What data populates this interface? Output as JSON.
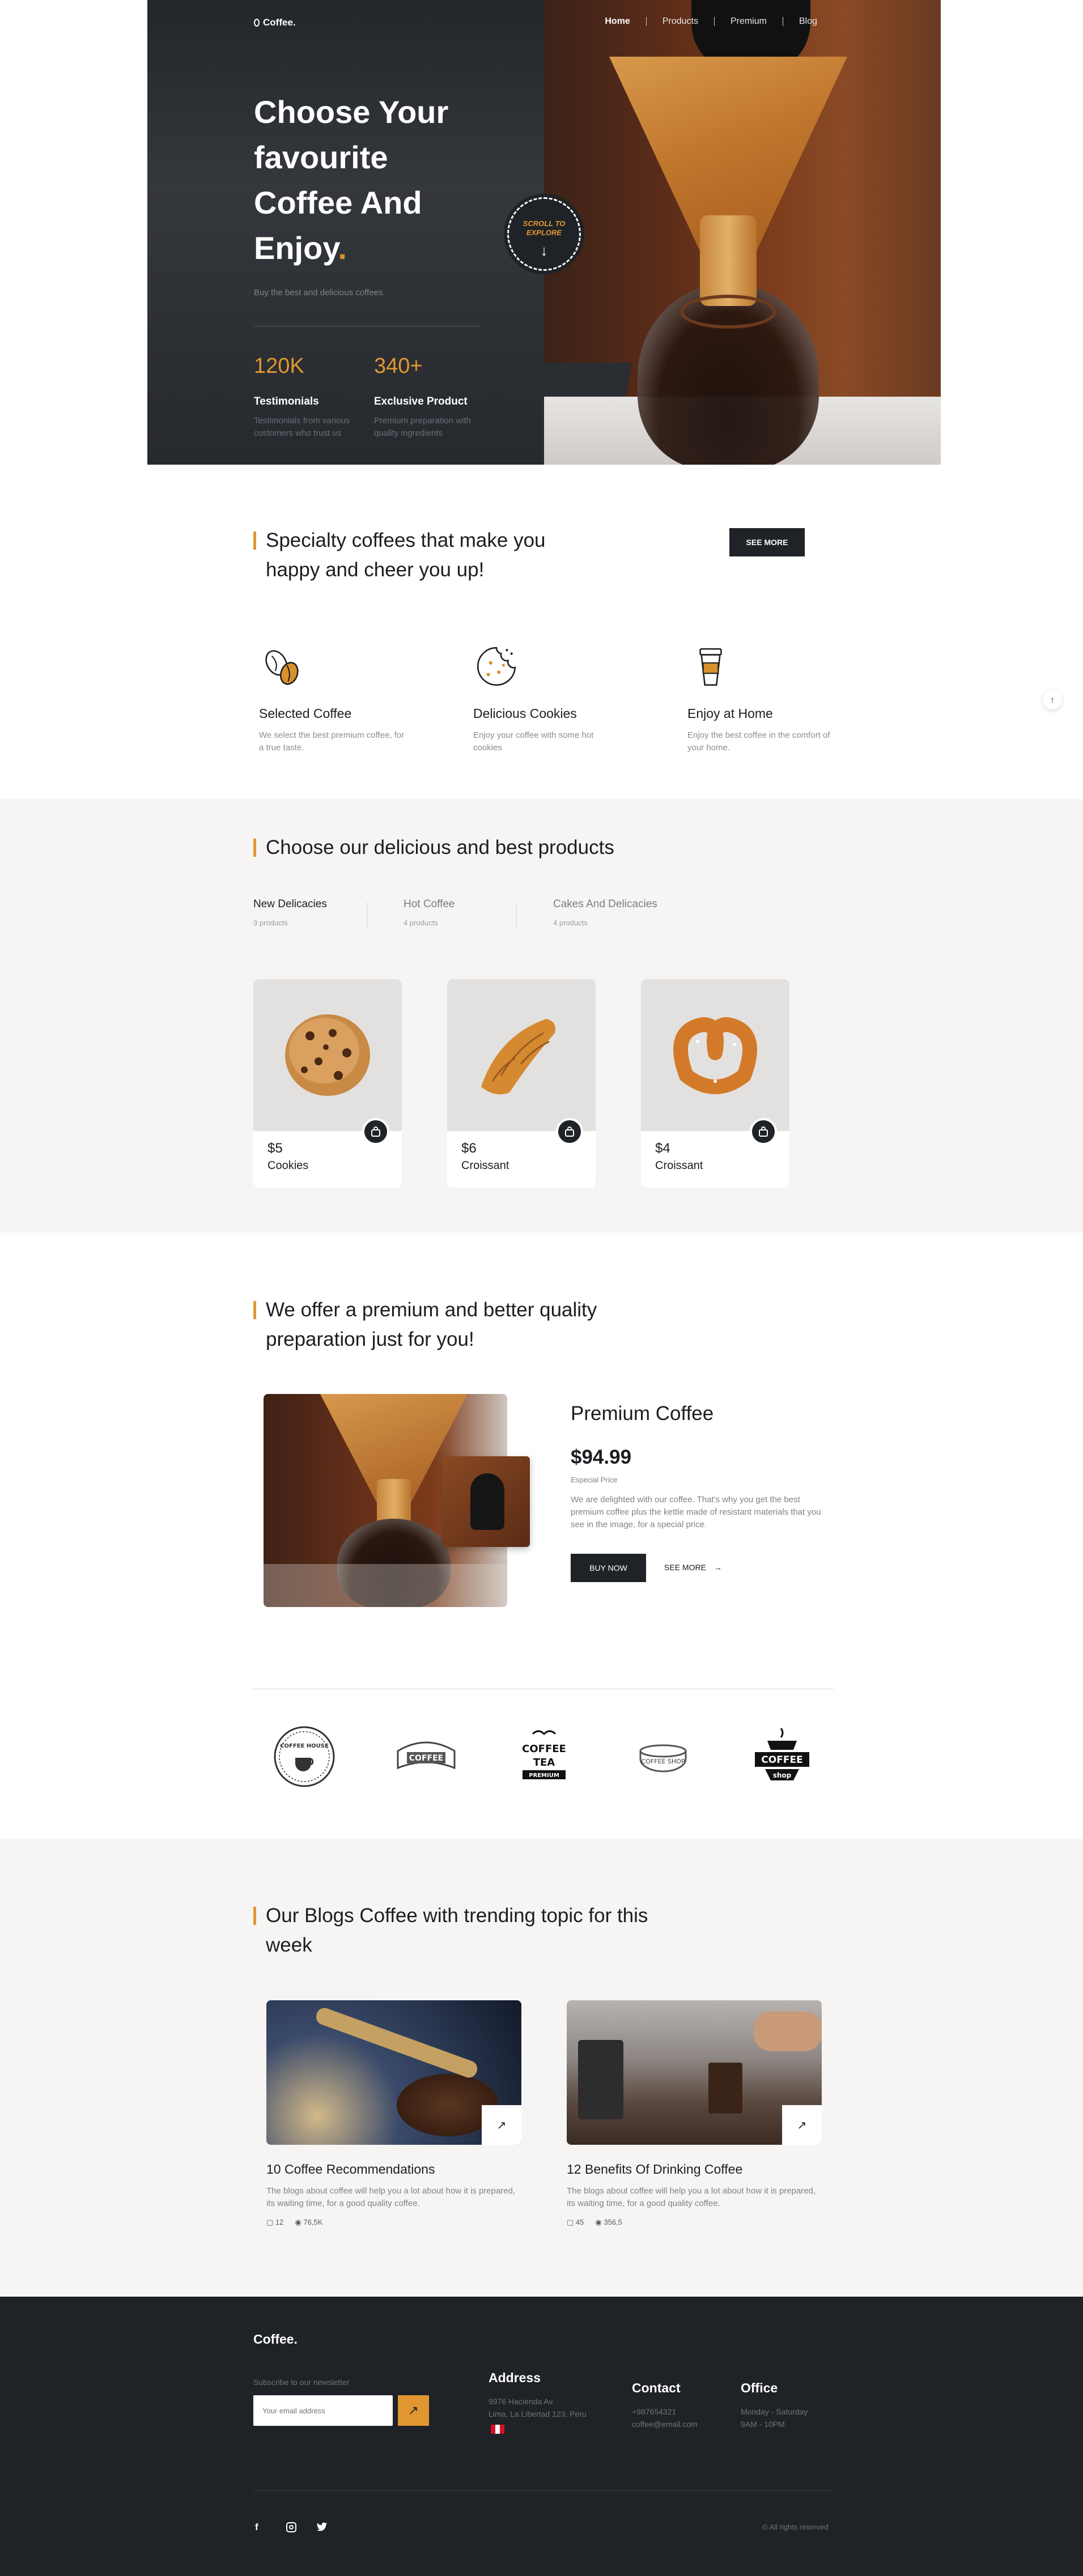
{
  "header": {
    "logo": "Coffee.",
    "nav": [
      "Home",
      "Products",
      "Premium",
      "Blog"
    ]
  },
  "hero": {
    "title": "Choose Your favourite Coffee And Enjoy",
    "title_dot": ".",
    "subtitle": "Buy the best and delicious coffees.",
    "badge_text_1": "SCROLL TO",
    "badge_text_2": "EXPLORE",
    "stats": [
      {
        "num": "120K",
        "label": "Testimonials",
        "desc": "Testimonials from various customers who trust us"
      },
      {
        "num": "340+",
        "label": "Exclusive Product",
        "desc": "Premium preparation with quality ingredients"
      }
    ]
  },
  "specialty": {
    "title": "Specialty coffees that make you happy and cheer you up!",
    "button": "SEE MORE",
    "features": [
      {
        "title": "Selected Coffee",
        "desc": "We select the best premium coffee, for a true taste.",
        "icon": "coffee-beans-icon"
      },
      {
        "title": "Delicious Cookies",
        "desc": "Enjoy your coffee with some hot cookies",
        "icon": "cookie-icon"
      },
      {
        "title": "Enjoy at Home",
        "desc": "Enjoy the best coffee in the comfort of your home.",
        "icon": "takeaway-cup-icon"
      }
    ]
  },
  "products": {
    "title": "Choose our delicious and best products",
    "tabs": [
      {
        "name": "New Delicacies",
        "count": "3 products"
      },
      {
        "name": "Hot Coffee",
        "count": "4 products"
      },
      {
        "name": "Cakes And Delicacies",
        "count": "4 products"
      }
    ],
    "items": [
      {
        "price": "$5",
        "name": "Cookies"
      },
      {
        "price": "$6",
        "name": "Croissant"
      },
      {
        "price": "$4",
        "name": "Croissant"
      }
    ]
  },
  "premium": {
    "title": "We offer a premium and better quality preparation just for you!",
    "name": "Premium Coffee",
    "price": "$94.99",
    "price_note": "Especial Price",
    "desc": "We are delighted with our coffee. That's why you get the best premium coffee plus the kettle made of resistant materials that you see in the image, for a special price.",
    "buy": "BUY NOW",
    "more": "SEE MORE"
  },
  "brands": {
    "b1": "COFFEE HOUSE",
    "b2": "COFFEE",
    "b3a": "COFFEE",
    "b3b": "TEA",
    "b3c": "PREMIUM",
    "b4": "COFFEE SHOP",
    "b5a": "COFFEE",
    "b5b": "shop"
  },
  "blogs": {
    "title": "Our Blogs Coffee with trending topic for this week",
    "items": [
      {
        "title": "10 Coffee Recommendations",
        "desc": "The blogs about coffee will help you a lot about how it is prepared, its waiting time, for a good quality coffee.",
        "comments": "12",
        "views": "76,5K"
      },
      {
        "title": "12 Benefits Of Drinking Coffee",
        "desc": "The blogs about coffee will help you a lot about how it is prepared, its waiting time, for a good quality coffee.",
        "comments": "45",
        "views": "356,5"
      }
    ]
  },
  "footer": {
    "logo": "Coffee.",
    "newsletter_label": "Subscribe to our newsletter",
    "email_placeholder": "Your email address",
    "address_title": "Address",
    "address_1": "9976 Hacienda Av.",
    "address_2": "Lima, La Libertad 123, Peru",
    "contact_title": "Contact",
    "phone": "+987654321",
    "email": "coffee@email.com",
    "office_title": "Office",
    "hours_1": "Monday - Saturday",
    "hours_2": "9AM - 10PM",
    "rights": "© All rights reserved"
  },
  "colors": {
    "accent": "#e09732",
    "dark": "#1f2226",
    "soft_bg": "#f6f5f4"
  }
}
